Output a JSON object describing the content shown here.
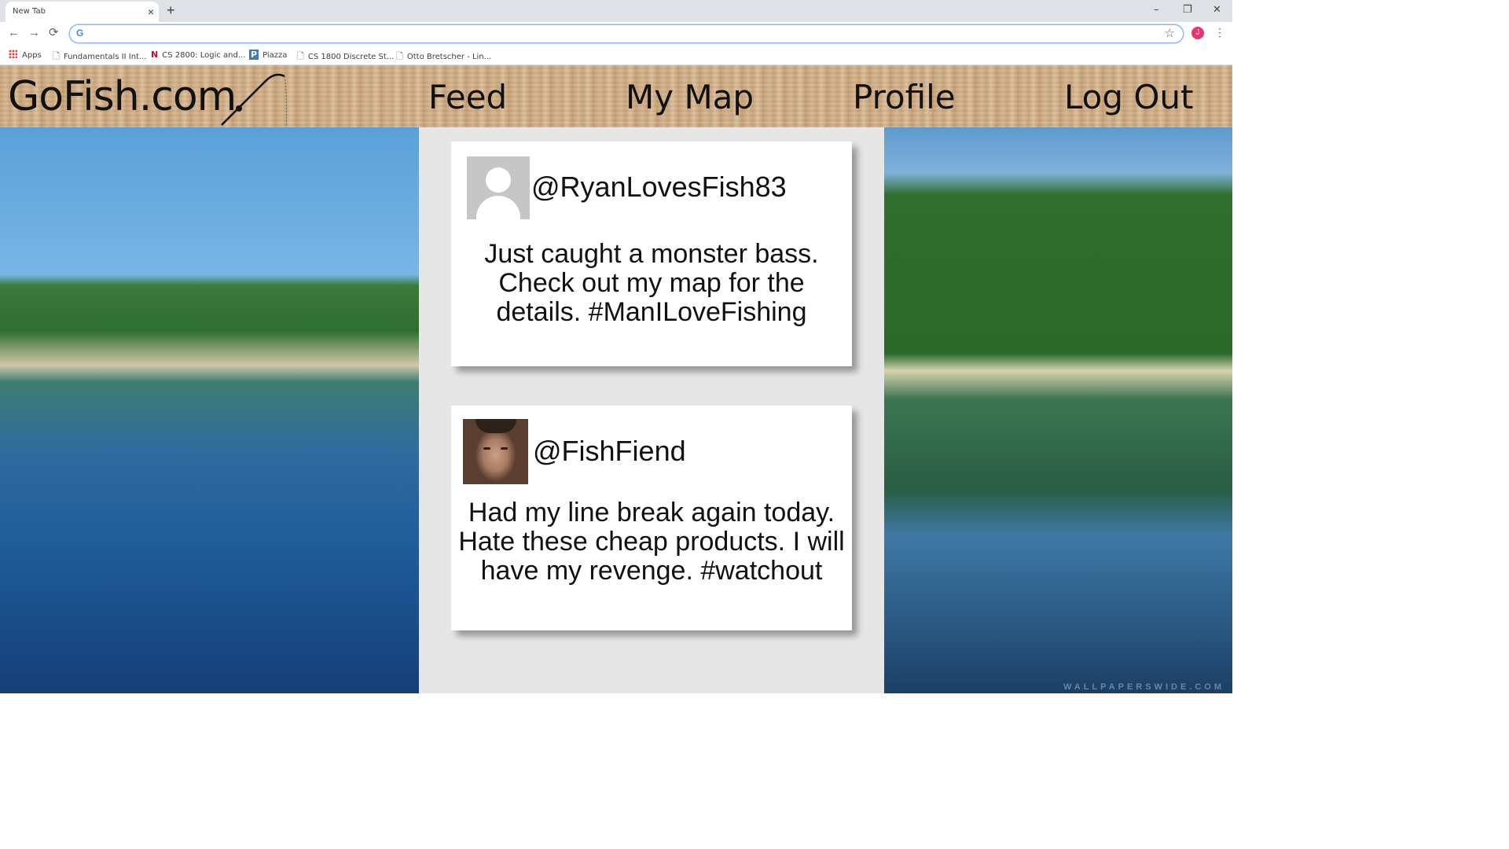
{
  "browser": {
    "tab_title": "New Tab",
    "tab_close": "×",
    "new_tab": "+",
    "window_controls": {
      "minimize": "–",
      "restore": "❐",
      "close": "✕"
    },
    "nav": {
      "back": "←",
      "forward": "→",
      "reload": "⟳"
    },
    "omnibox_value": "",
    "omnibox_icon": "G",
    "star": "☆",
    "profile_initial": "J",
    "menu": "⋮",
    "bookmarks": [
      {
        "label": "Apps",
        "icon": "apps-grid-icon"
      },
      {
        "label": "Fundamentals II Int...",
        "icon": "page-icon",
        "glyph": "🗋"
      },
      {
        "label": "CS 2800: Logic and...",
        "icon": "n-logo-icon",
        "glyph": "N"
      },
      {
        "label": "Piazza",
        "icon": "piazza-icon",
        "glyph": "P"
      },
      {
        "label": "CS 1800 Discrete St...",
        "icon": "page-icon",
        "glyph": "🗋"
      },
      {
        "label": "Otto Bretscher - Lin...",
        "icon": "page-icon",
        "glyph": "🗋"
      }
    ]
  },
  "site": {
    "logo": "GoFish.com",
    "nav": [
      "Feed",
      "My Map",
      "Profile",
      "Log Out"
    ],
    "watermark": "WALLPAPERSWIDE.COM",
    "posts": [
      {
        "username": "@RyanLovesFish83",
        "avatar": "default-avatar-icon",
        "lines": [
          "Just caught a monster bass.",
          "Check out my map for the",
          "details. #ManILoveFishing"
        ]
      },
      {
        "username": "@FishFiend",
        "avatar": "user-photo",
        "lines": [
          "Had my line break again today.",
          "Hate these cheap products. I will",
          "have my revenge. #watchout"
        ]
      }
    ]
  }
}
